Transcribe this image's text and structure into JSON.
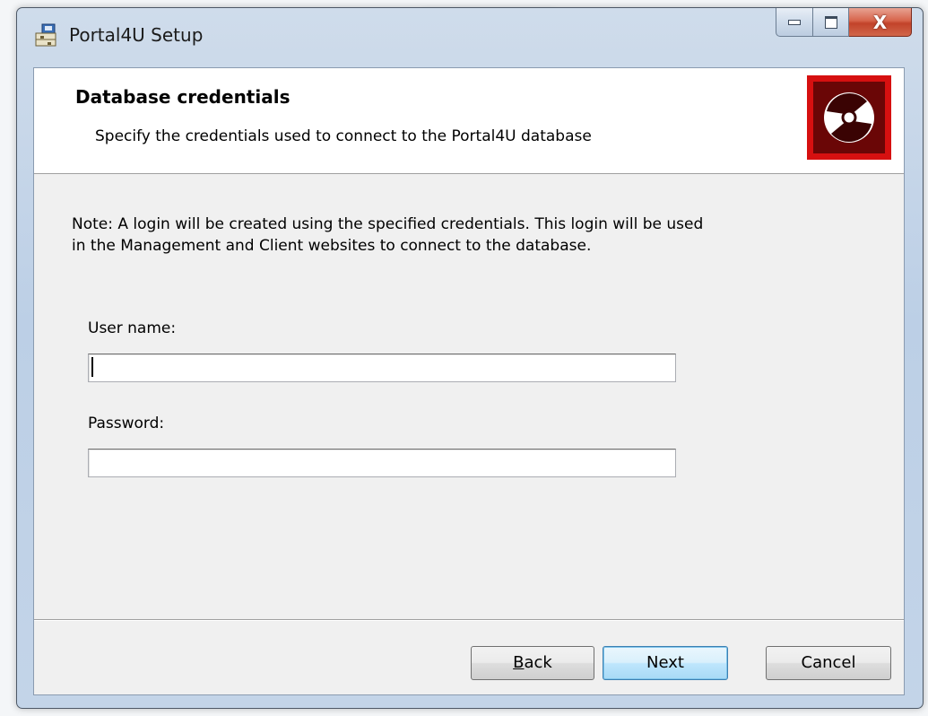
{
  "window": {
    "title": "Portal4U Setup",
    "controls": {
      "minimize": "minimize",
      "maximize": "maximize",
      "close": "X"
    }
  },
  "banner": {
    "title": "Database credentials",
    "subtitle": "Specify the credentials used to connect to the Portal4U database",
    "logo_icon": "disc-icon",
    "logo_color": "#d61010"
  },
  "body": {
    "note": "Note: A login will be created using the specified credentials. This login will be used in the Management and Client websites to connect to the database.",
    "user_name_label": "User name:",
    "user_name_value": "",
    "password_label": "Password:",
    "password_value": ""
  },
  "buttons": {
    "back_accel": "B",
    "back_rest": "ack",
    "next": "Next",
    "cancel": "Cancel"
  }
}
